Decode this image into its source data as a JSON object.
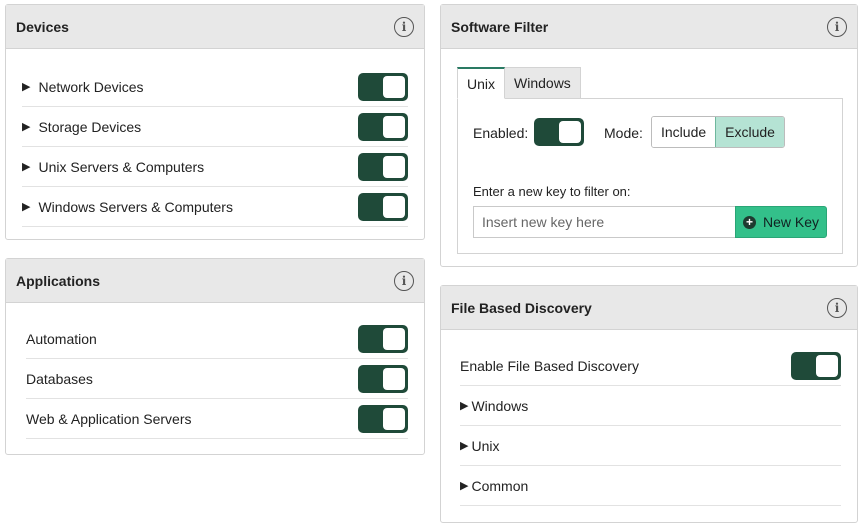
{
  "colors": {
    "toggle_on": "#1f4a39",
    "accent_green": "#33c08a",
    "selected_mode": "#b5e3d4"
  },
  "devices": {
    "title": "Devices",
    "items": [
      {
        "label": "Network Devices",
        "enabled": true
      },
      {
        "label": "Storage Devices",
        "enabled": true
      },
      {
        "label": "Unix Servers & Computers",
        "enabled": true
      },
      {
        "label": "Windows Servers & Computers",
        "enabled": true
      }
    ]
  },
  "applications": {
    "title": "Applications",
    "items": [
      {
        "label": "Automation",
        "enabled": true
      },
      {
        "label": "Databases",
        "enabled": true
      },
      {
        "label": "Web & Application Servers",
        "enabled": true
      }
    ]
  },
  "software_filter": {
    "title": "Software Filter",
    "tabs": [
      "Unix",
      "Windows"
    ],
    "active_tab": "Unix",
    "enabled_label": "Enabled:",
    "enabled": true,
    "mode_label": "Mode:",
    "modes": [
      "Include",
      "Exclude"
    ],
    "selected_mode": "Exclude",
    "key_prompt": "Enter a new key to filter on:",
    "key_placeholder": "Insert new key here",
    "new_key_label": "New Key"
  },
  "file_based_discovery": {
    "title": "File Based Discovery",
    "enable_label": "Enable File Based Discovery",
    "enabled": true,
    "items": [
      "Windows",
      "Unix",
      "Common"
    ]
  },
  "icons": {
    "info": "info-icon",
    "caret": "caret-right-icon",
    "plus": "plus-circle-icon"
  }
}
